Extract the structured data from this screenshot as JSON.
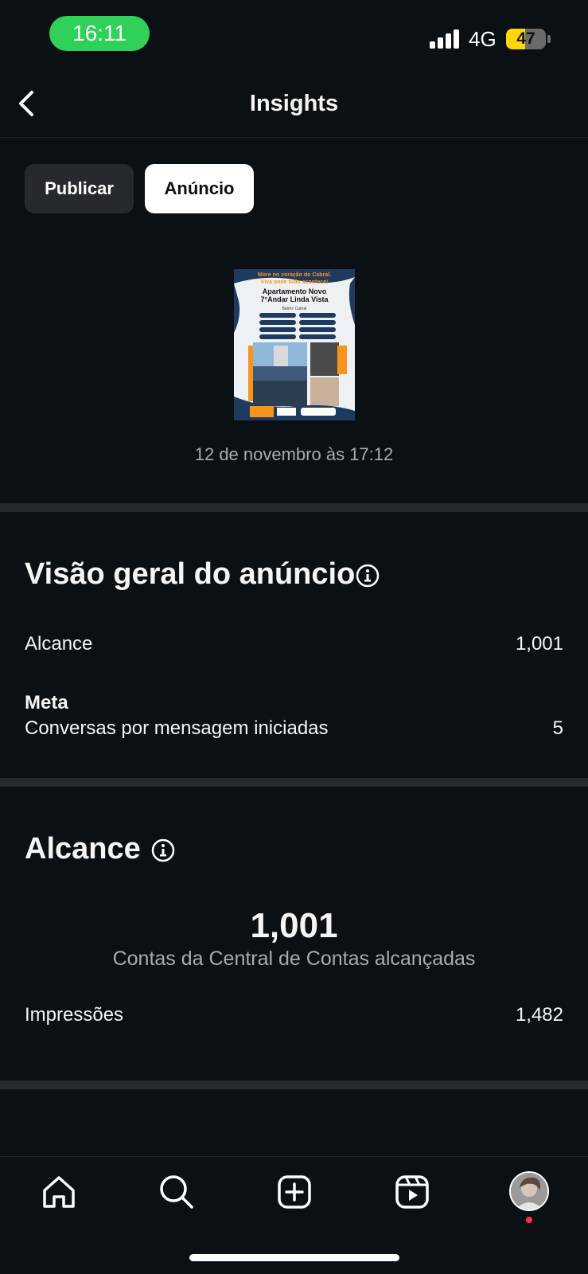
{
  "status_bar": {
    "time": "16:11",
    "network": "4G",
    "battery": "47",
    "battery_level": 0.47
  },
  "nav": {
    "title": "Insights"
  },
  "tabs": [
    {
      "label": "Publicar",
      "selected": false
    },
    {
      "label": "Anúncio",
      "selected": true
    }
  ],
  "post": {
    "headline_1": "More no coração do Cabral.",
    "headline_2": "Viva onde tudo acontece!",
    "title_1": "Apartamento Novo",
    "title_2": "7°Andar Linda Vista",
    "bairro": "Bairro: Cabral",
    "date": "12 de novembro às 17:12"
  },
  "overview": {
    "title": "Visão geral do anúncio",
    "rows": [
      {
        "label": "Alcance",
        "value": "1,001"
      }
    ],
    "meta_heading": "Meta",
    "meta_row": {
      "label": "Conversas por mensagem iniciadas",
      "value": "5"
    }
  },
  "reach": {
    "title": "Alcance",
    "big_value": "1,001",
    "caption": "Contas da Central de Contas alcançadas",
    "rows": [
      {
        "label": "Impressões",
        "value": "1,482"
      }
    ]
  },
  "bottom_nav": {
    "items": [
      "home-icon",
      "search-icon",
      "create-icon",
      "reels-icon",
      "profile-avatar"
    ]
  },
  "colors": {
    "background": "#0b1014",
    "time_pill": "#30d158",
    "battery": "#ffd60a",
    "notification": "#ff3040"
  }
}
